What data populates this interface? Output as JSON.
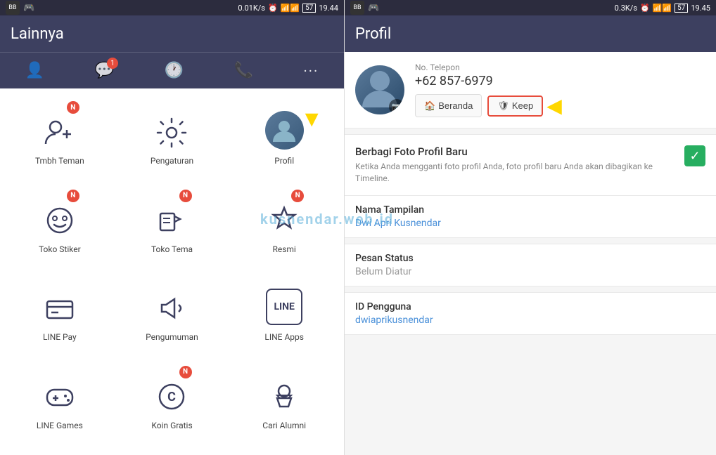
{
  "left": {
    "statusBar": {
      "bbIcon": "BB",
      "gameIcon": "🎮",
      "speed": "0.01K/s",
      "clockIcon": "⏰",
      "signalIcon": "📶",
      "batteryIcon": "57",
      "time": "19.44"
    },
    "header": {
      "title": "Lainnya"
    },
    "navItems": [
      {
        "icon": "👤",
        "badge": null,
        "label": ""
      },
      {
        "icon": "💬",
        "badge": "1",
        "label": ""
      },
      {
        "icon": "🕐",
        "badge": null,
        "label": ""
      },
      {
        "icon": "📞",
        "badge": null,
        "label": ""
      },
      {
        "icon": "···",
        "badge": null,
        "label": ""
      }
    ],
    "menuItems": [
      {
        "id": "tambah-teman",
        "label": "Tmbh Teman",
        "iconType": "person-add",
        "badge": "N"
      },
      {
        "id": "pengaturan",
        "label": "Pengaturan",
        "iconType": "gear",
        "badge": null
      },
      {
        "id": "profil",
        "label": "Profil",
        "iconType": "avatar",
        "badge": null
      },
      {
        "id": "toko-stiker",
        "label": "Toko Stiker",
        "iconType": "sticker",
        "badge": "N"
      },
      {
        "id": "toko-tema",
        "label": "Toko Tema",
        "iconType": "stamp",
        "badge": "N"
      },
      {
        "id": "resmi",
        "label": "Resmi",
        "iconType": "badge-star",
        "badge": "N"
      },
      {
        "id": "line-pay",
        "label": "LINE Pay",
        "iconType": "card",
        "badge": null
      },
      {
        "id": "pengumuman",
        "label": "Pengumuman",
        "iconType": "megaphone",
        "badge": null
      },
      {
        "id": "line-apps",
        "label": "LINE Apps",
        "iconType": "line-box",
        "badge": null
      },
      {
        "id": "line-games",
        "label": "LINE Games",
        "iconType": "gamepad",
        "badge": null
      },
      {
        "id": "koin-gratis",
        "label": "Koin Gratis",
        "iconType": "coin-c",
        "badge": "N"
      },
      {
        "id": "cari-alumni",
        "label": "Cari Alumni",
        "iconType": "graduate",
        "badge": null
      }
    ],
    "arrowLabel": "▼"
  },
  "right": {
    "statusBar": {
      "bbIcon": "BB",
      "gameIcon": "🎮",
      "speed": "0.3K/s",
      "clockIcon": "⏰",
      "signalIcon": "📶",
      "batteryIcon": "57",
      "time": "19.45"
    },
    "header": {
      "title": "Profil"
    },
    "profile": {
      "phoneLabel": "No. Telepon",
      "phoneNumber": "+62 857-6979",
      "buttons": [
        {
          "id": "beranda",
          "label": "Beranda",
          "icon": "🏠"
        },
        {
          "id": "keep",
          "label": "Keep",
          "icon": "🛡"
        }
      ]
    },
    "sections": [
      {
        "id": "berbagi-foto",
        "title": "Berbagi Foto Profil Baru",
        "subtitle": "Ketika Anda mengganti foto profil Anda, foto profil baru Anda akan dibagikan ke Timeline.",
        "toggle": "✓"
      }
    ],
    "details": [
      {
        "id": "nama-tampilan",
        "label": "Nama Tampilan",
        "value": "Dwi Apri Kusnendar",
        "isLink": true
      },
      {
        "id": "pesan-status",
        "label": "Pesan Status",
        "value": "Belum Diatur",
        "isLink": false
      },
      {
        "id": "id-pengguna",
        "label": "ID Pengguna",
        "value": "dwiaprikusnendar",
        "isLink": true
      }
    ],
    "arrowLabel": "←"
  },
  "watermark": "kusnendar.web.id"
}
